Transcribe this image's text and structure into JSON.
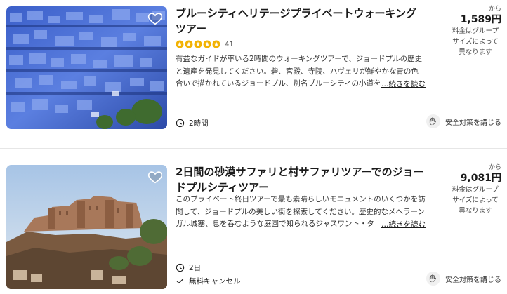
{
  "listings": [
    {
      "title": "ブルーシティヘリテージプライベートウォーキングツアー",
      "rating_stars": 5,
      "rating_count": "41",
      "description": "有益なガイドが率いる2時間のウォーキングツアーで、ジョードプルの歴史と遺産を発見してください。砦、宮殿、寺院、ハヴェリが鮮やかな青の色合いで描かれているジョードプル、別名ブルーシティの小道を",
      "read_more": "…続きを読む",
      "duration": "2時間",
      "price_prefix": "から",
      "price": "1,589円",
      "price_note": "料金はグループサイズによって異なります",
      "safety": "安全対策を講じる",
      "image_icon": "blue-city-photo",
      "favorite_icon": "heart-icon"
    },
    {
      "title": "2日間の砂漠サファリと村サファリツアーでのジョードプルシティツアー",
      "description": "このプライベート終日ツアーで最も素晴らしいモニュメントのいくつかを訪問して、ジョードプルの美しい街を探索してください。歴史的なメヘラーンガル城塞、息を呑むような庭園で知られるジャスワント・タ",
      "read_more": "…続きを読む",
      "duration": "2日",
      "cancellation": "無料キャンセル",
      "price_prefix": "から",
      "price": "9,081円",
      "price_note": "料金はグループサイズによって異なります",
      "safety": "安全対策を講じる",
      "image_icon": "fort-photo",
      "favorite_icon": "heart-icon"
    }
  ],
  "colors": {
    "star": "#f2b203",
    "text": "#1a1a1a",
    "divider": "#e6e6e6"
  }
}
